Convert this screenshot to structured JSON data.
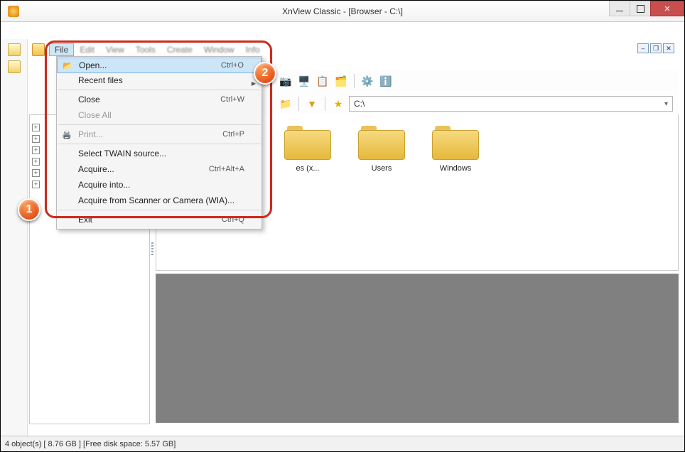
{
  "title": "XnView Classic - [Browser - C:\\]",
  "menubar": {
    "file": "File",
    "edit": "Edit",
    "view": "View",
    "tools": "Tools",
    "create": "Create",
    "window": "Window",
    "info": "Info"
  },
  "file_menu": {
    "open": "Open...",
    "open_sc": "Ctrl+O",
    "recent": "Recent files",
    "close": "Close",
    "close_sc": "Ctrl+W",
    "close_all": "Close All",
    "print": "Print...",
    "print_sc": "Ctrl+P",
    "twain": "Select TWAIN source...",
    "acquire": "Acquire...",
    "acquire_sc": "Ctrl+Alt+A",
    "acquire_into": "Acquire into...",
    "acquire_wia": "Acquire from Scanner or Camera (WIA)...",
    "exit": "Exit",
    "exit_sc": "Ctrl+Q"
  },
  "address": "C:\\",
  "folders": [
    {
      "label": "es (x..."
    },
    {
      "label": "Users"
    },
    {
      "label": "Windows"
    }
  ],
  "status": "4 object(s) [ 8.76 GB ] [Free disk space: 5.57 GB]",
  "badges": {
    "one": "1",
    "two": "2"
  }
}
